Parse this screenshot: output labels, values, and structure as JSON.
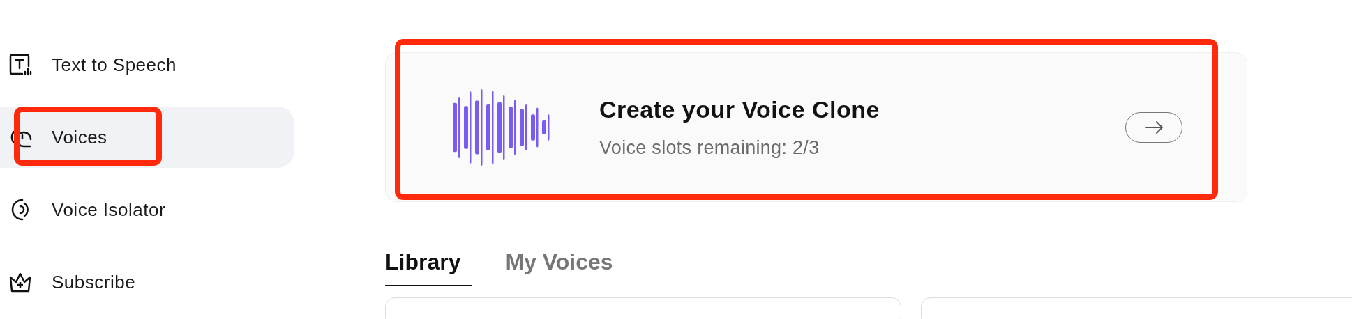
{
  "sidebar": {
    "items": [
      {
        "label": "Text to Speech",
        "selected": false,
        "highlighted": false
      },
      {
        "label": "Voices",
        "selected": true,
        "highlighted": true
      },
      {
        "label": "Voice Isolator",
        "selected": false,
        "highlighted": false
      },
      {
        "label": "Subscribe",
        "selected": false,
        "highlighted": false
      }
    ]
  },
  "clone_card": {
    "title": "Create your Voice Clone",
    "subtitle": "Voice slots remaining: 2/3",
    "highlighted": true
  },
  "tabs": [
    {
      "label": "Library",
      "selected": true
    },
    {
      "label": "My Voices",
      "selected": false
    }
  ],
  "library_cards": [
    {
      "kind": "card"
    },
    {
      "kind": "card"
    }
  ]
}
